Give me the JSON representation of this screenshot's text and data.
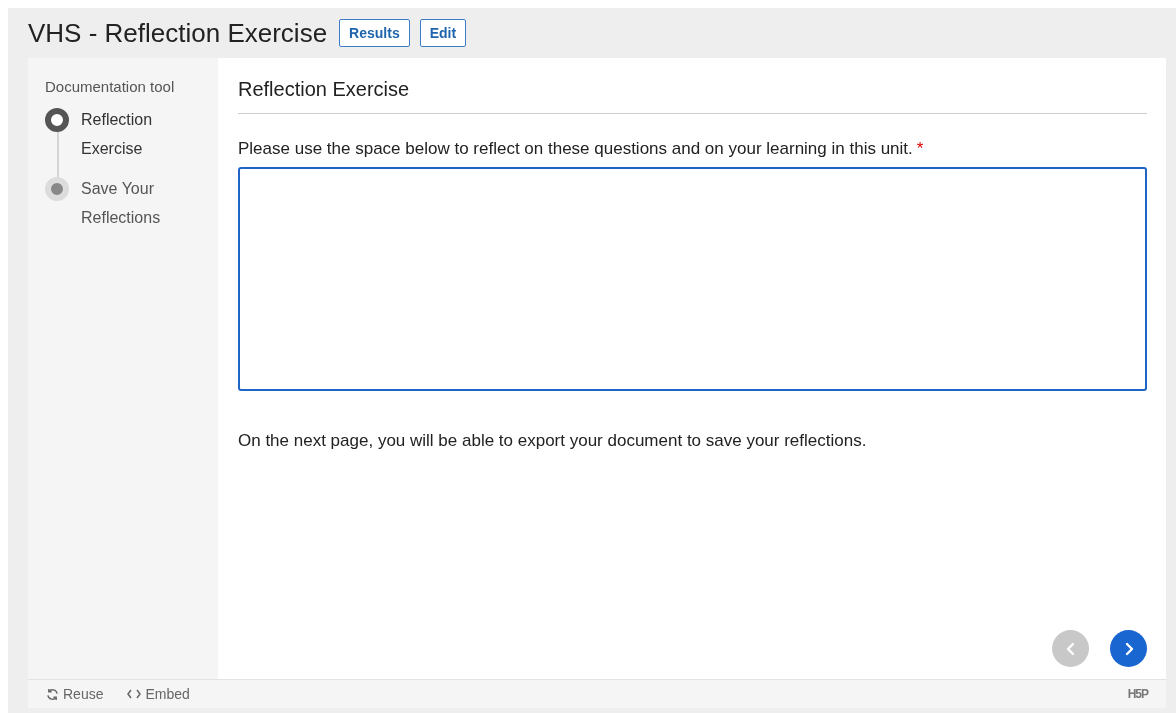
{
  "title": "VHS - Reflection Exercise",
  "header_buttons": [
    {
      "label": "Results"
    },
    {
      "label": "Edit"
    }
  ],
  "sidebar": {
    "title": "Documentation tool",
    "steps": [
      {
        "label": "Reflection Exercise",
        "selected": true
      },
      {
        "label": "Save Your Reflections",
        "selected": false
      }
    ]
  },
  "page": {
    "heading": "Reflection Exercise",
    "prompt": "Please use the space below to reflect on these questions and on your learning in this unit.",
    "required": true,
    "required_mark": "*",
    "note": "On the next page, you will be able to export your document to save your reflections."
  },
  "nav": {
    "previous": {
      "disabled": true
    },
    "next": {
      "disabled": false
    }
  },
  "footer": {
    "links": [
      {
        "kind": "reuse",
        "label": "Reuse"
      },
      {
        "kind": "embed",
        "label": "Embed"
      }
    ],
    "logo": "H5P"
  }
}
